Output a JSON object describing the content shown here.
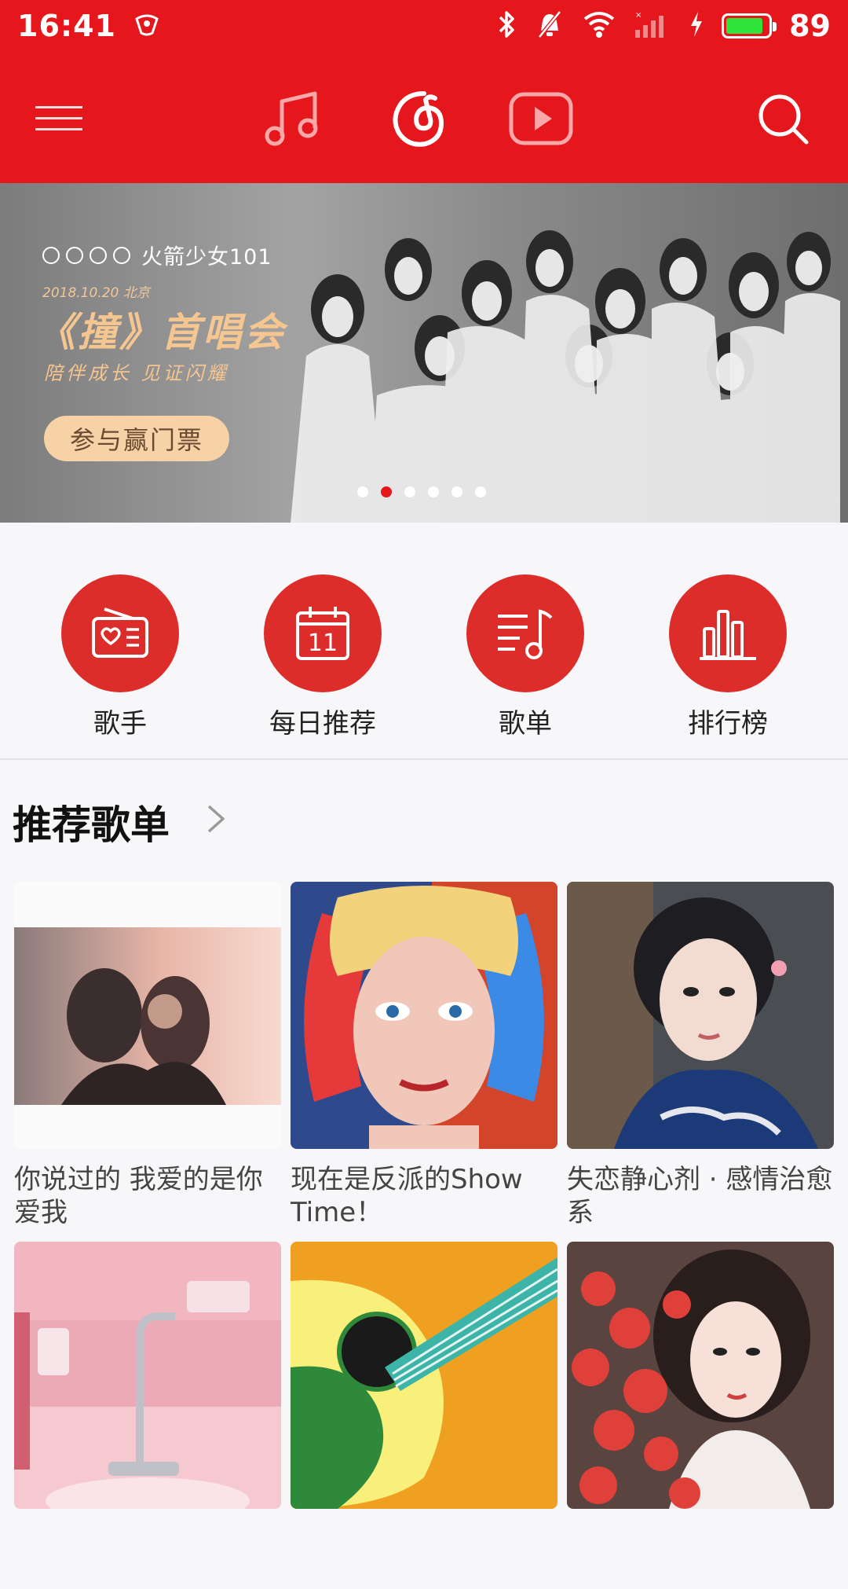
{
  "status_bar": {
    "time": "16:41",
    "battery_level": "89",
    "battery_color": "#2ee33a"
  },
  "top_nav": {
    "icons": [
      "menu-icon",
      "music-note-icon",
      "netease-logo-icon",
      "video-play-icon",
      "search-icon"
    ]
  },
  "banner": {
    "brand": "火箭少女101",
    "date": "2018.10.20 北京",
    "title": "《撞》首唱会",
    "subtitle": "陪伴成长 见证闪耀",
    "cta": "参与赢门票",
    "dots_total": 6,
    "dots_active": 2
  },
  "categories": [
    {
      "label": "歌手",
      "icon": "radio-heart-icon"
    },
    {
      "label": "每日推荐",
      "icon": "calendar-icon",
      "day": "11"
    },
    {
      "label": "歌单",
      "icon": "playlist-icon"
    },
    {
      "label": "排行榜",
      "icon": "chart-bars-icon"
    }
  ],
  "section": {
    "title": "推荐歌单"
  },
  "playlists": [
    {
      "title": "你说过的 我爱的是你爱我"
    },
    {
      "title": "现在是反派的Show Time！"
    },
    {
      "title": "失恋静心剂 · 感情治愈系"
    },
    {
      "title": ""
    },
    {
      "title": ""
    },
    {
      "title": ""
    }
  ],
  "colors": {
    "brand_red": "#e5161c",
    "category_red": "#dd2d2a",
    "cta_gold": "#f6d2a6"
  }
}
